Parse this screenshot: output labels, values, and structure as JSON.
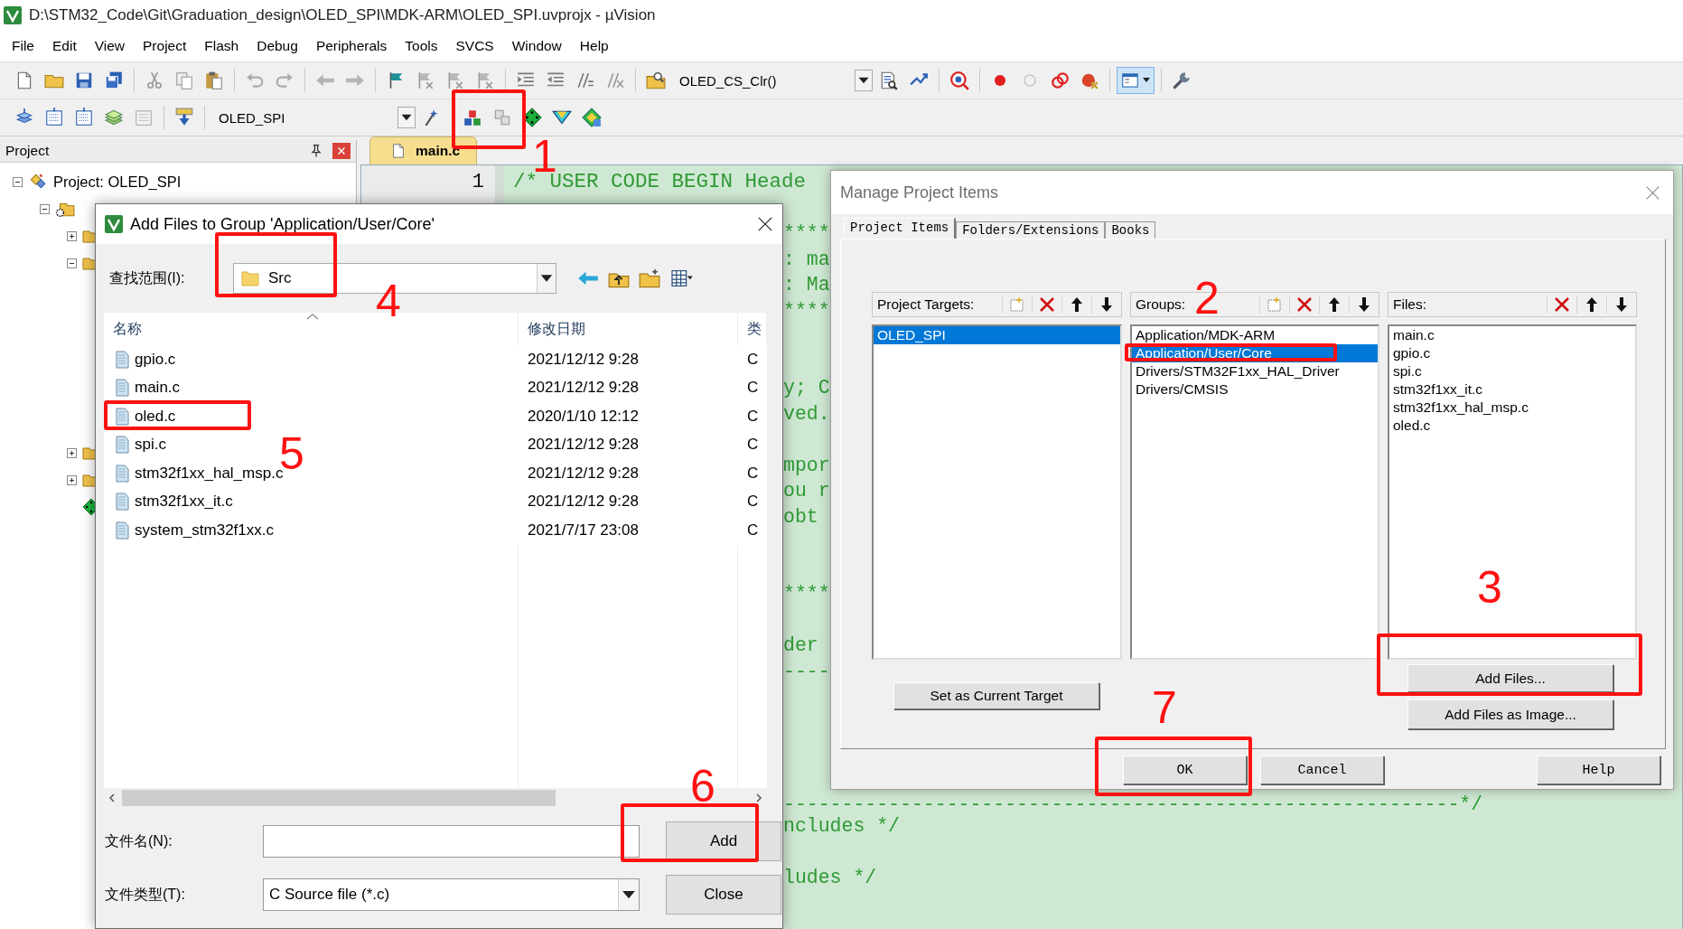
{
  "window": {
    "title": "D:\\STM32_Code\\Git\\Graduation_design\\OLED_SPI\\MDK-ARM\\OLED_SPI.uvprojx - µVision"
  },
  "menu": [
    "File",
    "Edit",
    "View",
    "Project",
    "Flash",
    "Debug",
    "Peripherals",
    "Tools",
    "SVCS",
    "Window",
    "Help"
  ],
  "toolbar": {
    "find_combo": "OLED_CS_Clr()",
    "target_combo": "OLED_SPI"
  },
  "project_panel": {
    "title": "Project",
    "tree": [
      {
        "kind": "project",
        "label": "Project: OLED_SPI",
        "expanded": true,
        "children": [
          {
            "kind": "target",
            "expanded": true,
            "children": [
              {
                "kind": "folder",
                "expanded": false
              },
              {
                "kind": "folder",
                "expanded": true
              },
              {
                "kind": "folder",
                "expanded": false
              },
              {
                "kind": "folder",
                "expanded": false
              },
              {
                "kind": "component"
              }
            ]
          }
        ]
      }
    ]
  },
  "editor": {
    "tab": "main.c",
    "line_number": "1",
    "first_line": "/* USER CODE BEGIN Heade",
    "fragments": [
      "****",
      ": ma",
      ": Ma",
      "****",
      "y; C",
      "ved.",
      "mpor",
      "ou r",
      "obt",
      "****",
      "der",
      "----",
      "----------------------------------------------------------*/",
      "ncludes */",
      "ludes */"
    ]
  },
  "add_files_dialog": {
    "title": "Add Files to Group 'Application/User/Core'",
    "look_in_label": "查找范围(I):",
    "look_in": "Src",
    "columns": [
      "名称",
      "修改日期",
      "类"
    ],
    "files": [
      {
        "name": "gpio.c",
        "modified": "2021/12/12 9:28",
        "type": "C"
      },
      {
        "name": "main.c",
        "modified": "2021/12/12 9:28",
        "type": "C"
      },
      {
        "name": "oled.c",
        "modified": "2020/1/10 12:12",
        "type": "C"
      },
      {
        "name": "spi.c",
        "modified": "2021/12/12 9:28",
        "type": "C"
      },
      {
        "name": "stm32f1xx_hal_msp.c",
        "modified": "2021/12/12 9:28",
        "type": "C"
      },
      {
        "name": "stm32f1xx_it.c",
        "modified": "2021/12/12 9:28",
        "type": "C"
      },
      {
        "name": "system_stm32f1xx.c",
        "modified": "2021/7/17 23:08",
        "type": "C"
      }
    ],
    "file_name_label": "文件名(N):",
    "file_type_label": "文件类型(T):",
    "file_type": "C Source file (*.c)",
    "buttons": [
      "Add",
      "Close"
    ]
  },
  "manage_dialog": {
    "title": "Manage Project Items",
    "tabs": [
      {
        "label": "Project Items",
        "selected": true
      },
      {
        "label": "Folders/Extensions",
        "selected": false
      },
      {
        "label": "Books",
        "selected": false
      }
    ],
    "targets": {
      "label": "Project Targets:",
      "items": [
        {
          "label": "OLED_SPI",
          "selected": true
        }
      ]
    },
    "groups": {
      "label": "Groups:",
      "items": [
        {
          "label": "Application/MDK-ARM",
          "selected": false
        },
        {
          "label": "Application/User/Core",
          "selected": true
        },
        {
          "label": "Drivers/STM32F1xx_HAL_Driver",
          "selected": false
        },
        {
          "label": "Drivers/CMSIS",
          "selected": false
        }
      ]
    },
    "files": {
      "label": "Files:",
      "items": [
        {
          "label": "main.c",
          "selected": false
        },
        {
          "label": "gpio.c",
          "selected": false
        },
        {
          "label": "spi.c",
          "selected": false
        },
        {
          "label": "stm32f1xx_it.c",
          "selected": false
        },
        {
          "label": "stm32f1xx_hal_msp.c",
          "selected": false
        },
        {
          "label": "oled.c",
          "selected": false
        }
      ]
    },
    "set_target_button": "Set as Current Target",
    "add_buttons": [
      "Add Files...",
      "Add Files as Image..."
    ],
    "footer_buttons": [
      "OK",
      "Cancel",
      "Help"
    ]
  },
  "annotations": [
    {
      "number": "1"
    },
    {
      "number": "2"
    },
    {
      "number": "3"
    },
    {
      "number": "4"
    },
    {
      "number": "5"
    },
    {
      "number": "6"
    },
    {
      "number": "7"
    }
  ]
}
